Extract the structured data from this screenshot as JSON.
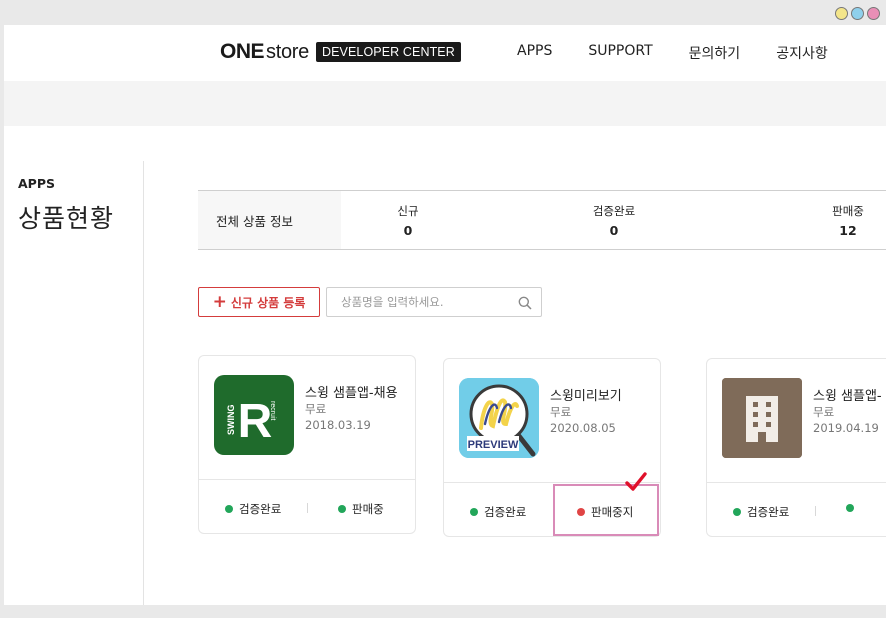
{
  "header": {
    "logo_one": "ONE",
    "logo_store": "store",
    "logo_badge": "DEVELOPER CENTER",
    "nav": [
      "APPS",
      "SUPPORT",
      "문의하기",
      "공지사항"
    ]
  },
  "sidebar": {
    "sub": "APPS",
    "title": "상품현황"
  },
  "stats": {
    "label": "전체 상품 정보",
    "items": [
      {
        "label": "신규",
        "value": "0"
      },
      {
        "label": "검증완료",
        "value": "0"
      },
      {
        "label": "판매중",
        "value": "12"
      }
    ]
  },
  "actions": {
    "register_label": "신규 상품 등록",
    "search_placeholder": "상품명을 입력하세요."
  },
  "apps": [
    {
      "name": "스윙 샘플앱-채용",
      "price": "무료",
      "date": "2018.03.19",
      "status1": "검증완료",
      "status2": "판매중",
      "status2_color": "#22a65a"
    },
    {
      "name": "스윙미리보기",
      "price": "무료",
      "date": "2020.08.05",
      "status1": "검증완료",
      "status2": "판매중지",
      "status2_color": "#e04545"
    },
    {
      "name": "스윙 샘플앱-",
      "price": "무료",
      "date": "2019.04.19",
      "status1": "검증완료",
      "status2": "",
      "status2_color": "#22a65a"
    }
  ],
  "icons": {
    "recruit": {
      "letter": "R",
      "side": "SWING",
      "vertical": "recruit"
    },
    "preview": {
      "label": "PREVIEW"
    }
  },
  "colors": {
    "accent": "#d43c3c",
    "verified": "#22a65a",
    "stopped": "#e04545",
    "highlight": "#d98bb8"
  }
}
